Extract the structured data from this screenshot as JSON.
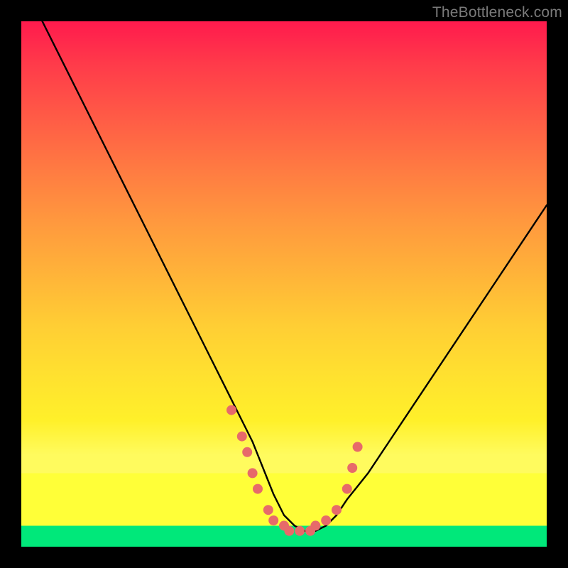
{
  "watermark": "TheBottleneck.com",
  "chart_data": {
    "type": "line",
    "title": "",
    "xlabel": "",
    "ylabel": "",
    "xlim": [
      0,
      100
    ],
    "ylim": [
      0,
      100
    ],
    "grid": false,
    "legend": false,
    "series": [
      {
        "name": "bottleneck-curve",
        "x": [
          4,
          8,
          12,
          16,
          20,
          24,
          28,
          32,
          36,
          40,
          42,
          44,
          46,
          48,
          50,
          52,
          54,
          56,
          58,
          60,
          62,
          66,
          70,
          74,
          78,
          82,
          86,
          90,
          94,
          98,
          100
        ],
        "values": [
          100,
          92,
          84,
          76,
          68,
          60,
          52,
          44,
          36,
          28,
          24,
          20,
          15,
          10,
          6,
          4,
          3,
          3,
          4,
          6,
          9,
          14,
          20,
          26,
          32,
          38,
          44,
          50,
          56,
          62,
          65
        ]
      }
    ],
    "markers": {
      "name": "highlight-dots",
      "color": "#e76a6a",
      "x": [
        40,
        42,
        43,
        44,
        45,
        47,
        48,
        50,
        51,
        53,
        55,
        56,
        58,
        60,
        62,
        63,
        64
      ],
      "values": [
        26,
        21,
        18,
        14,
        11,
        7,
        5,
        4,
        3,
        3,
        3,
        4,
        5,
        7,
        11,
        15,
        19
      ]
    }
  }
}
